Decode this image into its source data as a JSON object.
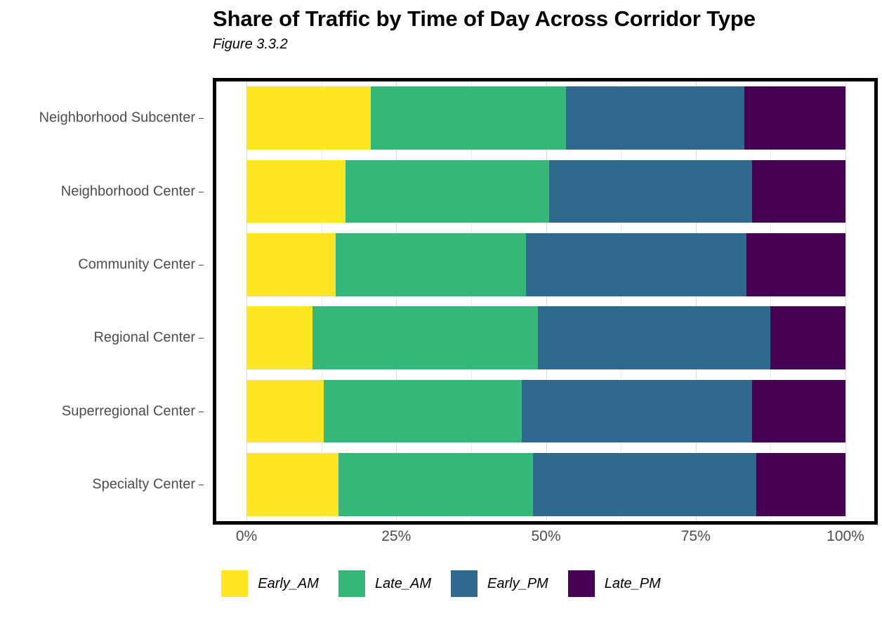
{
  "chart_data": {
    "type": "bar",
    "orientation": "horizontal",
    "stacked": true,
    "normalized": true,
    "title": "Share of Traffic by Time of Day Across Corridor Type",
    "subtitle": "Figure 3.3.2",
    "xlabel": "",
    "ylabel": "",
    "xlim": [
      0,
      100
    ],
    "x_ticks": [
      "0%",
      "25%",
      "50%",
      "75%",
      "100%"
    ],
    "x_tick_values": [
      0,
      25,
      50,
      75,
      100
    ],
    "grid": true,
    "legend_position": "bottom",
    "categories": [
      "Neighborhood Subcenter",
      "Neighborhood Center",
      "Community Center",
      "Regional Center",
      "Superregional Center",
      "Specialty Center"
    ],
    "series": [
      {
        "name": "Early_AM",
        "color": "#FDE725",
        "values": [
          20.8,
          16.5,
          14.9,
          11.0,
          12.9,
          15.3
        ]
      },
      {
        "name": "Late_AM",
        "color": "#35B779",
        "values": [
          32.5,
          34.0,
          31.8,
          37.6,
          33.0,
          32.5
        ]
      },
      {
        "name": "Early_PM",
        "color": "#31688E",
        "values": [
          29.8,
          33.9,
          36.8,
          38.8,
          38.5,
          37.3
        ]
      },
      {
        "name": "Late_PM",
        "color": "#440154",
        "values": [
          16.9,
          15.6,
          16.5,
          12.6,
          15.6,
          14.9
        ]
      }
    ],
    "colors": {
      "early_am": "#FDE725",
      "late_am": "#35B779",
      "early_pm": "#31688E",
      "late_pm": "#440154",
      "axis_text": "#4D4D4D",
      "grid": "#D9D9D9",
      "frame": "#000000",
      "background": "#FFFFFF"
    }
  },
  "legend": {
    "items": [
      {
        "label": "Early_AM",
        "color": "#FDE725"
      },
      {
        "label": "Late_AM",
        "color": "#35B779"
      },
      {
        "label": "Early_PM",
        "color": "#31688E"
      },
      {
        "label": "Late_PM",
        "color": "#440154"
      }
    ]
  }
}
